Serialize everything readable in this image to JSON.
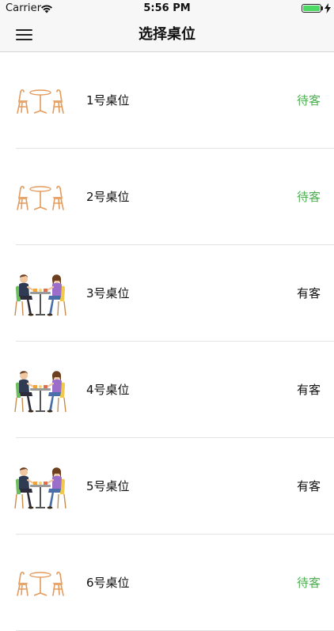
{
  "status_bar": {
    "carrier": "Carrier",
    "time": "5:56 PM",
    "battery_level": 1.0
  },
  "nav": {
    "title": "选择桌位",
    "menu_icon": "hamburger-menu-icon"
  },
  "colors": {
    "free_status": "#4caf50",
    "occupied_status": "#111111",
    "chair_orange": "#e8a56c"
  },
  "tables": [
    {
      "label": "1号桌位",
      "status": "待客",
      "occupied": false,
      "icon": "empty-table-icon"
    },
    {
      "label": "2号桌位",
      "status": "待客",
      "occupied": false,
      "icon": "empty-table-icon"
    },
    {
      "label": "3号桌位",
      "status": "有客",
      "occupied": true,
      "icon": "couple-dining-icon"
    },
    {
      "label": "4号桌位",
      "status": "有客",
      "occupied": true,
      "icon": "couple-dining-icon"
    },
    {
      "label": "5号桌位",
      "status": "有客",
      "occupied": true,
      "icon": "couple-dining-icon"
    },
    {
      "label": "6号桌位",
      "status": "待客",
      "occupied": false,
      "icon": "empty-table-icon"
    }
  ]
}
